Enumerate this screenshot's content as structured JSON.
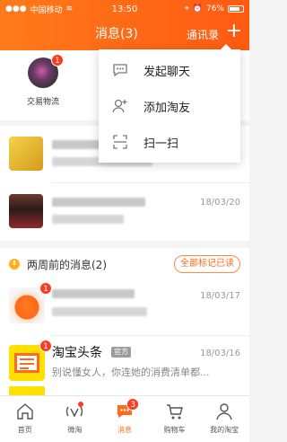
{
  "status_bar": {
    "carrier": "中国移动",
    "time": "13:50",
    "battery": "76%"
  },
  "header": {
    "title": "消息(3)",
    "contacts_label": "通讯录",
    "add_label": "+"
  },
  "shortcuts": [
    {
      "label": "交易物流",
      "badge": "1"
    }
  ],
  "dropdown": {
    "items": [
      {
        "label": "发起聊天",
        "icon": "chat-bubble-icon"
      },
      {
        "label": "添加淘友",
        "icon": "add-friend-icon"
      },
      {
        "label": "扫一扫",
        "icon": "scan-icon"
      }
    ]
  },
  "messages": [
    {
      "date": ""
    },
    {
      "date": "18/03/20"
    }
  ],
  "section": {
    "title": "两周前的消息(2)",
    "mark_all_read": "全部标记已读",
    "rows": [
      {
        "badge": "1",
        "date": "18/03/17",
        "name": "",
        "preview": ""
      },
      {
        "badge": "1",
        "date": "18/03/16",
        "name": "淘宝头条",
        "official": "官方",
        "preview": "别说懂女人，你连她的消费清单都..."
      }
    ]
  },
  "tabbar": {
    "items": [
      {
        "label": "首页",
        "icon": "home-icon"
      },
      {
        "label": "微淘",
        "icon": "weitao-icon",
        "dot": true
      },
      {
        "label": "消息",
        "icon": "message-icon",
        "badge": "3",
        "active": true
      },
      {
        "label": "购物车",
        "icon": "cart-icon"
      },
      {
        "label": "我的淘宝",
        "icon": "profile-icon"
      }
    ]
  },
  "colors": {
    "accent": "#ff6a1c",
    "badge": "#ff3b1f"
  }
}
